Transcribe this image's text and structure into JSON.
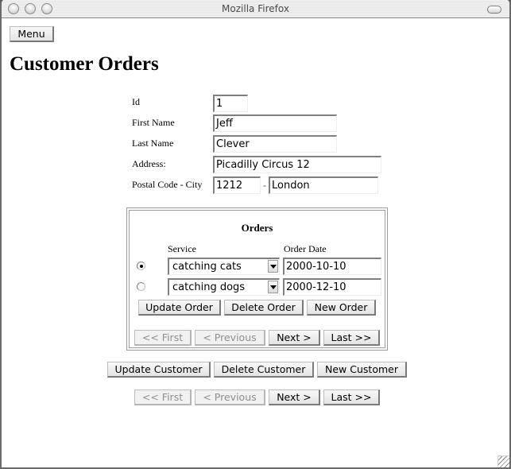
{
  "window": {
    "title": "Mozilla Firefox"
  },
  "menu_button": "Menu",
  "page_title": "Customer Orders",
  "customer": {
    "id_label": "Id",
    "id_value": "1",
    "first_name_label": "First Name",
    "first_name_value": "Jeff",
    "last_name_label": "Last Name",
    "last_name_value": "Clever",
    "address_label": "Address:",
    "address_value": "Picadilly Circus 12",
    "postal_city_label": "Postal Code - City",
    "postal_value": "1212",
    "separator": "-",
    "city_value": "London"
  },
  "orders": {
    "title": "Orders",
    "col_service": "Service",
    "col_date": "Order Date",
    "rows": [
      {
        "selected": true,
        "service": "catching cats",
        "date": "2000-10-10"
      },
      {
        "selected": false,
        "service": "catching dogs",
        "date": "2000-12-10"
      }
    ],
    "actions": {
      "update": "Update Order",
      "delete": "Delete Order",
      "new": "New Order"
    },
    "nav": {
      "first": "<< First",
      "previous": "< Previous",
      "next": "Next >",
      "last": "Last >>"
    }
  },
  "customer_actions": {
    "update": "Update Customer",
    "delete": "Delete Customer",
    "new": "New Customer"
  },
  "customer_nav": {
    "first": "<< First",
    "previous": "< Previous",
    "next": "Next >",
    "last": "Last >>"
  }
}
